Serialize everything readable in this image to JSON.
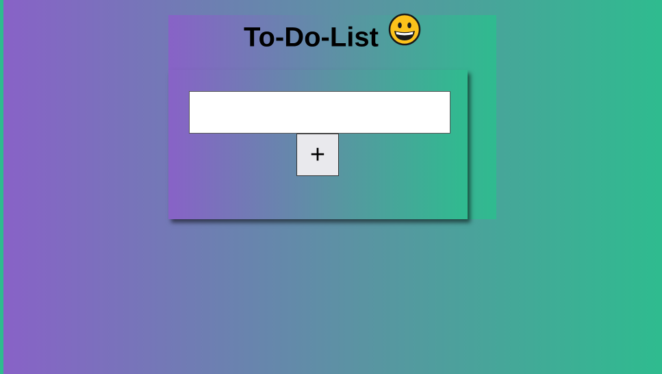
{
  "header": {
    "title": "To-Do-List",
    "emoji": "grinning-face-icon"
  },
  "form": {
    "input_value": "",
    "input_placeholder": "",
    "add_label": "+"
  },
  "colors": {
    "gradient_start": "#8862c7",
    "gradient_end": "#2fbb8f",
    "input_bg": "#ffffff",
    "button_bg": "#e9e9ed"
  }
}
